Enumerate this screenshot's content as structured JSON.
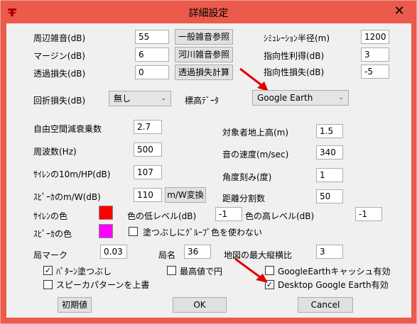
{
  "window": {
    "title": "詳細設定",
    "close_glyph": "✕"
  },
  "colors": {
    "titlebar": "#eb5a4a",
    "siren_color": "#ff0000",
    "speaker_color": "#ff00ff",
    "annotation_arrow": "#e00000"
  },
  "noise": {
    "ambient_label": "周辺雑音(dB)",
    "ambient_value": "55",
    "margin_label": "マージン(dB)",
    "margin_value": "6",
    "transmission_label": "透過損失(dB)",
    "transmission_value": "0",
    "general_button": "一般雑音参照",
    "river_button": "河川雑音参照",
    "transmission_button": "透過損失計算"
  },
  "simulation": {
    "radius_label": "ｼﾐｭﾚｰｼｮﾝ半径(m)",
    "radius_value": "1200",
    "gain_label": "指向性利得(dB)",
    "gain_value": "3",
    "loss_label": "指向性損失(dB)",
    "loss_value": "-5"
  },
  "diffraction": {
    "label": "回折損失(dB)",
    "value": "無し"
  },
  "elevation": {
    "label": "標高ﾃﾞｰﾀ",
    "value": "Google Earth"
  },
  "physics": {
    "free_space_label": "自由空間減衰乗数",
    "free_space_value": "2.7",
    "frequency_label": "周波数(Hz)",
    "frequency_value": "500",
    "siren_hp_label": "ｻｲﾚﾝの10m/HP(dB)",
    "siren_hp_value": "107",
    "speaker_w_label": "ｽﾋﾟｰｶのm/W(dB)",
    "speaker_w_value": "110",
    "mw_button": "m/W変換",
    "height_label": "対象者地上高(m)",
    "height_value": "1.5",
    "sound_speed_label": "音の速度(m/sec)",
    "sound_speed_value": "340",
    "angle_label": "角度刻み(度)",
    "angle_value": "1",
    "distance_label": "距離分割数",
    "distance_value": "50"
  },
  "colors_section": {
    "siren_label": "ｻｲﾚﾝの色",
    "speaker_label": "ｽﾋﾟｰｶの色",
    "low_level_label": "色の低レベル(dB)",
    "low_level_value": "-1",
    "high_level_label": "色の高レベル(dB)",
    "high_level_value": "-1",
    "no_group_color_label": "塗つぶしにｸﾞﾙｰﾌﾟ色を使わない"
  },
  "station": {
    "mark_label": "局マーク",
    "mark_value": "0.03",
    "name_label": "局名",
    "name_value": "36",
    "aspect_label": "地図の最大縦横比",
    "aspect_value": "3"
  },
  "checkboxes": {
    "pattern_fill": "ﾊﾟﾀｰﾝ塗つぶし",
    "max_circle": "最高値で円",
    "ge_cache": "GoogleEarthキャッシュ有効",
    "speaker_overwrite": "スピーカパターンを上書",
    "desktop_ge": "Desktop Google Earth有効",
    "checkmark": "✓"
  },
  "footer": {
    "initial_button": "初期値",
    "ok_button": "OK",
    "cancel_button": "Cancel"
  }
}
